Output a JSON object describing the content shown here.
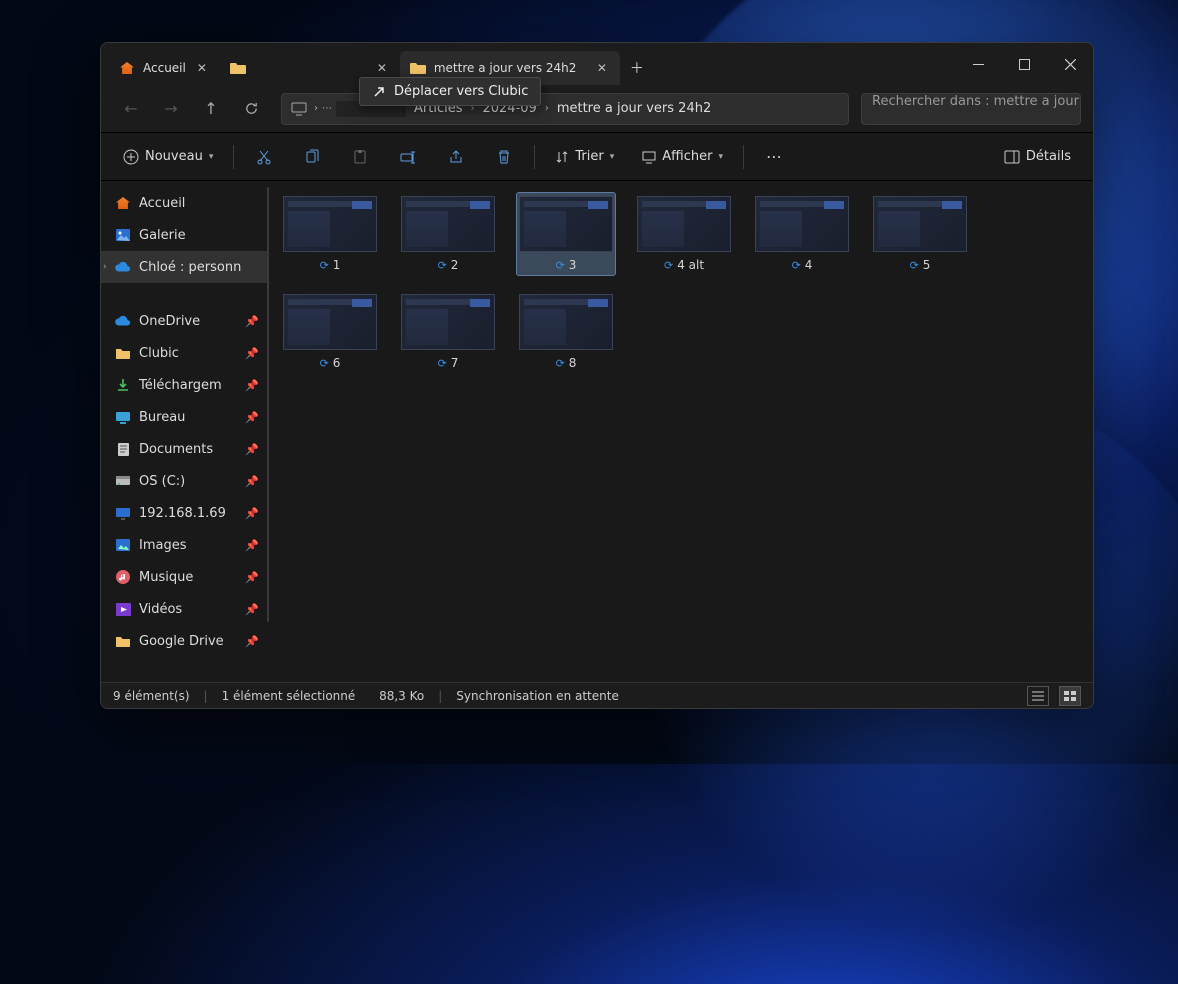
{
  "tabs": [
    {
      "label": "Accueil",
      "active": false,
      "icon": "home"
    },
    {
      "label": "",
      "active": false,
      "icon": "folder"
    },
    {
      "label": "mettre a jour vers 24h2",
      "active": true,
      "icon": "folder"
    }
  ],
  "drag_tooltip": "Déplacer vers Clubic",
  "breadcrumb": [
    "Articles",
    "2024-09",
    "mettre a jour vers 24h2"
  ],
  "search_placeholder": "Rechercher dans : mettre a jour v",
  "toolbar": {
    "nouveau": "Nouveau",
    "trier": "Trier",
    "afficher": "Afficher",
    "details": "Détails"
  },
  "sidebar": {
    "top": [
      {
        "label": "Accueil",
        "icon": "home"
      },
      {
        "label": "Galerie",
        "icon": "gallery"
      },
      {
        "label": "Chloé : personn",
        "icon": "onedrive",
        "selected": true,
        "expandable": true
      }
    ],
    "pinned": [
      {
        "label": "OneDrive",
        "icon": "onedrive"
      },
      {
        "label": "Clubic",
        "icon": "folder-y"
      },
      {
        "label": "Téléchargem",
        "icon": "download"
      },
      {
        "label": "Bureau",
        "icon": "desktop"
      },
      {
        "label": "Documents",
        "icon": "doc"
      },
      {
        "label": "OS (C:)",
        "icon": "drive"
      },
      {
        "label": "192.168.1.69",
        "icon": "monitor"
      },
      {
        "label": "Images",
        "icon": "images"
      },
      {
        "label": "Musique",
        "icon": "music"
      },
      {
        "label": "Vidéos",
        "icon": "video"
      },
      {
        "label": "Google Drive",
        "icon": "folder-y"
      }
    ]
  },
  "files": [
    {
      "name": "1",
      "selected": false
    },
    {
      "name": "2",
      "selected": false
    },
    {
      "name": "3",
      "selected": true
    },
    {
      "name": "4 alt",
      "selected": false
    },
    {
      "name": "4",
      "selected": false
    },
    {
      "name": "5",
      "selected": false
    },
    {
      "name": "6",
      "selected": false
    },
    {
      "name": "7",
      "selected": false
    },
    {
      "name": "8",
      "selected": false
    }
  ],
  "status": {
    "count": "9 élément(s)",
    "selection": "1 élément sélectionné",
    "size": "88,3 Ko",
    "sync": "Synchronisation en attente"
  }
}
